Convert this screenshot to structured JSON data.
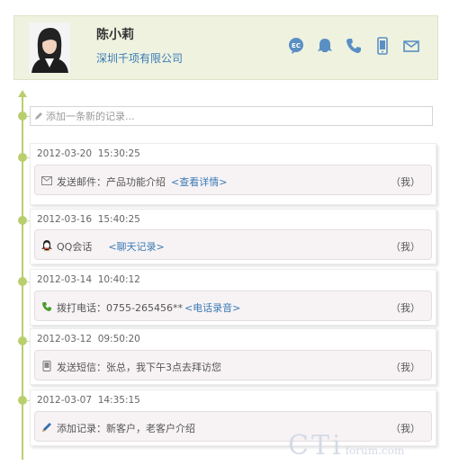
{
  "contact": {
    "name": "陈小莉",
    "company": "深圳千项有限公司"
  },
  "header_icons": [
    "ec-chat-icon",
    "qq-icon",
    "phone-icon",
    "mobile-icon",
    "mail-icon"
  ],
  "new_record": {
    "placeholder": "添加一条新的记录..."
  },
  "entries": [
    {
      "timestamp": "2012-03-20  15:30:25",
      "icon": "mail-icon",
      "text": "发送邮件：产品功能介绍",
      "link": "<查看详情>",
      "owner": "（我）"
    },
    {
      "timestamp": "2012-03-16  15:40:25",
      "icon": "qq-icon",
      "text": "QQ会话",
      "link": "<聊天记录>",
      "owner": "（我）"
    },
    {
      "timestamp": "2012-03-14  10:40:12",
      "icon": "phone-icon",
      "text": "拨打电话：0755-265456**",
      "link": "<电话录音>",
      "owner": "（我）"
    },
    {
      "timestamp": "2012-03-12  09:50:20",
      "icon": "sms-icon",
      "text": "发送短信：张总，我下午3点去拜访您",
      "link": "",
      "owner": "（我）"
    },
    {
      "timestamp": "2012-03-07  14:35:15",
      "icon": "pen-icon",
      "text": "添加记录：新客户，老客户介绍",
      "link": "",
      "owner": "（我）"
    }
  ],
  "watermark": {
    "big": "CTi",
    "small": "forum.com"
  },
  "colors": {
    "accent": "#b9cf6d",
    "link": "#3a7ab5",
    "header_bg": "#eef2df",
    "icon": "#5a8fc4"
  }
}
